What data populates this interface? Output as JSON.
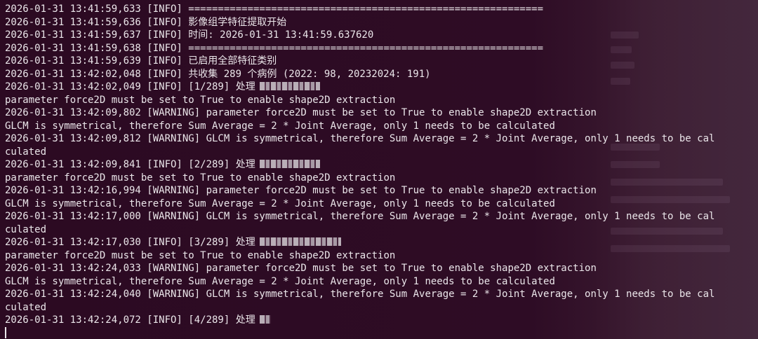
{
  "log_lines": [
    "2026-01-31 13:41:59,633 [INFO] ============================================================",
    "2026-01-31 13:41:59,636 [INFO] 影像组学特征提取开始",
    "2026-01-31 13:41:59,637 [INFO] 时间: 2026-01-31 13:41:59.637620",
    "2026-01-31 13:41:59,638 [INFO] ============================================================",
    "2026-01-31 13:41:59,639 [INFO] 已启用全部特征类别",
    "2026-01-31 13:42:02,048 [INFO] 共收集 289 个病例 (2022: 98, 20232024: 191)",
    "2026-01-31 13:42:02,049 [INFO] [1/289] 处理",
    "parameter force2D must be set to True to enable shape2D extraction",
    "2026-01-31 13:42:09,802 [WARNING] parameter force2D must be set to True to enable shape2D extraction",
    "GLCM is symmetrical, therefore Sum Average = 2 * Joint Average, only 1 needs to be calculated",
    "2026-01-31 13:42:09,812 [WARNING] GLCM is symmetrical, therefore Sum Average = 2 * Joint Average, only 1 needs to be cal",
    "culated",
    "2026-01-31 13:42:09,841 [INFO] [2/289] 处理",
    "parameter force2D must be set to True to enable shape2D extraction",
    "2026-01-31 13:42:16,994 [WARNING] parameter force2D must be set to True to enable shape2D extraction",
    "GLCM is symmetrical, therefore Sum Average = 2 * Joint Average, only 1 needs to be calculated",
    "2026-01-31 13:42:17,000 [WARNING] GLCM is symmetrical, therefore Sum Average = 2 * Joint Average, only 1 needs to be cal",
    "culated",
    "2026-01-31 13:42:17,030 [INFO] [3/289] 处理",
    "parameter force2D must be set to True to enable shape2D extraction",
    "2026-01-31 13:42:24,033 [WARNING] parameter force2D must be set to True to enable shape2D extraction",
    "GLCM is symmetrical, therefore Sum Average = 2 * Joint Average, only 1 needs to be calculated",
    "2026-01-31 13:42:24,040 [WARNING] GLCM is symmetrical, therefore Sum Average = 2 * Joint Average, only 1 needs to be cal",
    "culated",
    "2026-01-31 13:42:24,072 [INFO] [4/289] 处理"
  ],
  "colors": {
    "background": "#2c0a22",
    "text": "#ebe6ea"
  }
}
